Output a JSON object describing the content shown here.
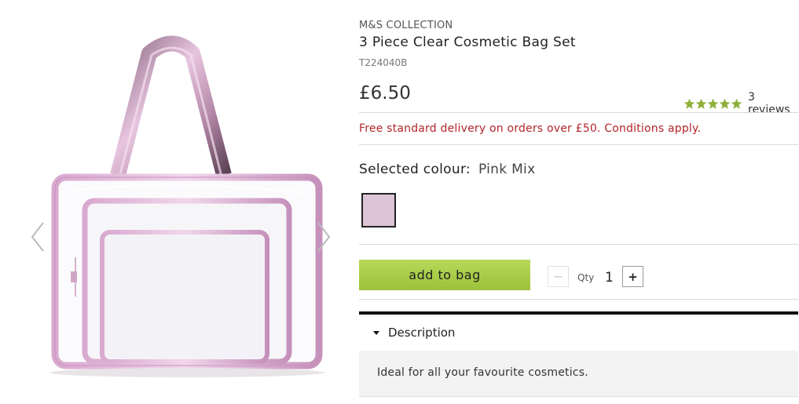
{
  "product": {
    "brand": "M&S COLLECTION",
    "title": "3 Piece Clear Cosmetic Bag Set",
    "code": "T224040B",
    "price": "£6.50",
    "rating": 5,
    "reviews": "3 reviews",
    "delivery_note": "Free standard delivery on orders over £50. Conditions apply."
  },
  "colour": {
    "label": "Selected colour:",
    "value": "Pink Mix",
    "swatch_color": "#dcc5d6"
  },
  "purchase": {
    "add_label": "add to bag",
    "qty_label": "Qty",
    "qty_value": "1",
    "minus_icon": "−",
    "plus_icon": "+"
  },
  "description": {
    "heading": "Description",
    "text": "Ideal for all your favourite cosmetics."
  },
  "colors": {
    "accent_green": "#a8cc46",
    "delivery_red": "#b3252b",
    "star_green": "#8fb13a"
  },
  "icons": {
    "prev": "chevron-left-icon",
    "next": "chevron-right-icon",
    "star": "star-icon",
    "caret": "caret-down-icon"
  }
}
